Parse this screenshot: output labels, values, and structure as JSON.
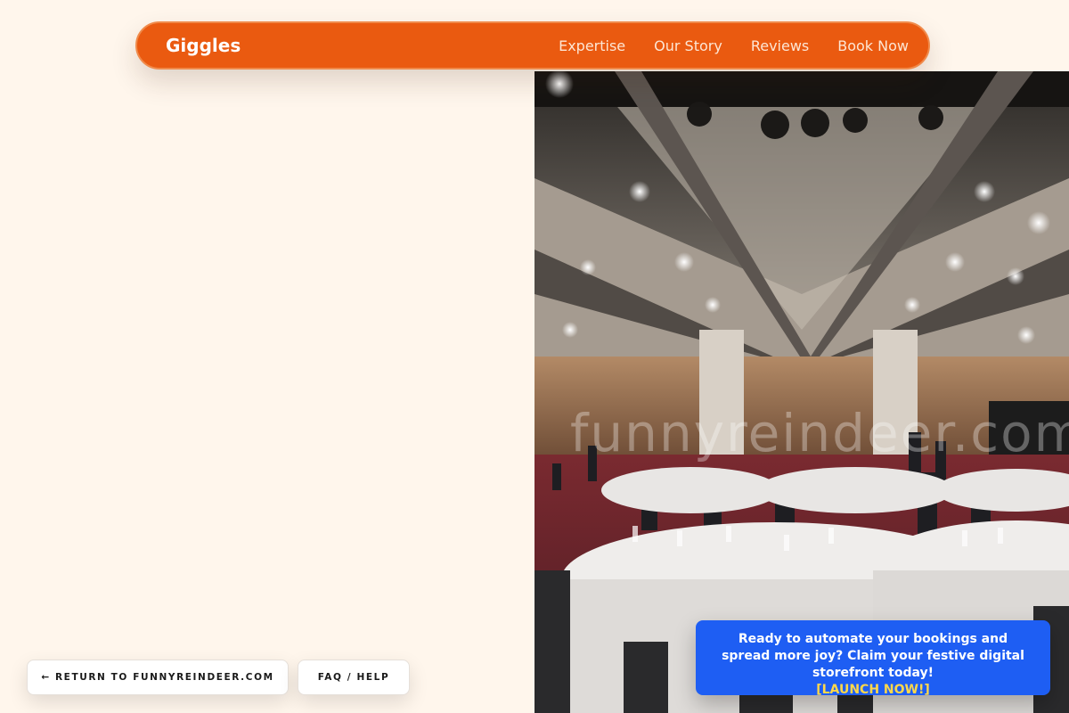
{
  "nav": {
    "brand": "Giggles",
    "links": [
      "Expertise",
      "Our Story",
      "Reviews",
      "Book Now"
    ],
    "accent_color": "#ea5a10"
  },
  "hero": {
    "image_subject": "banquet hall with round dinner tables and guests",
    "watermark": "funnyreindeer.com"
  },
  "footer_buttons": {
    "return_label": "← RETURN TO FUNNYREINDEER.COM",
    "faq_label": "FAQ / HELP"
  },
  "promo": {
    "message": "Ready to automate your bookings and spread more joy? Claim your festive digital storefront today!",
    "cta": "[LAUNCH NOW!]",
    "background_color": "#1e5ef3",
    "cta_color": "#ffd84a"
  }
}
